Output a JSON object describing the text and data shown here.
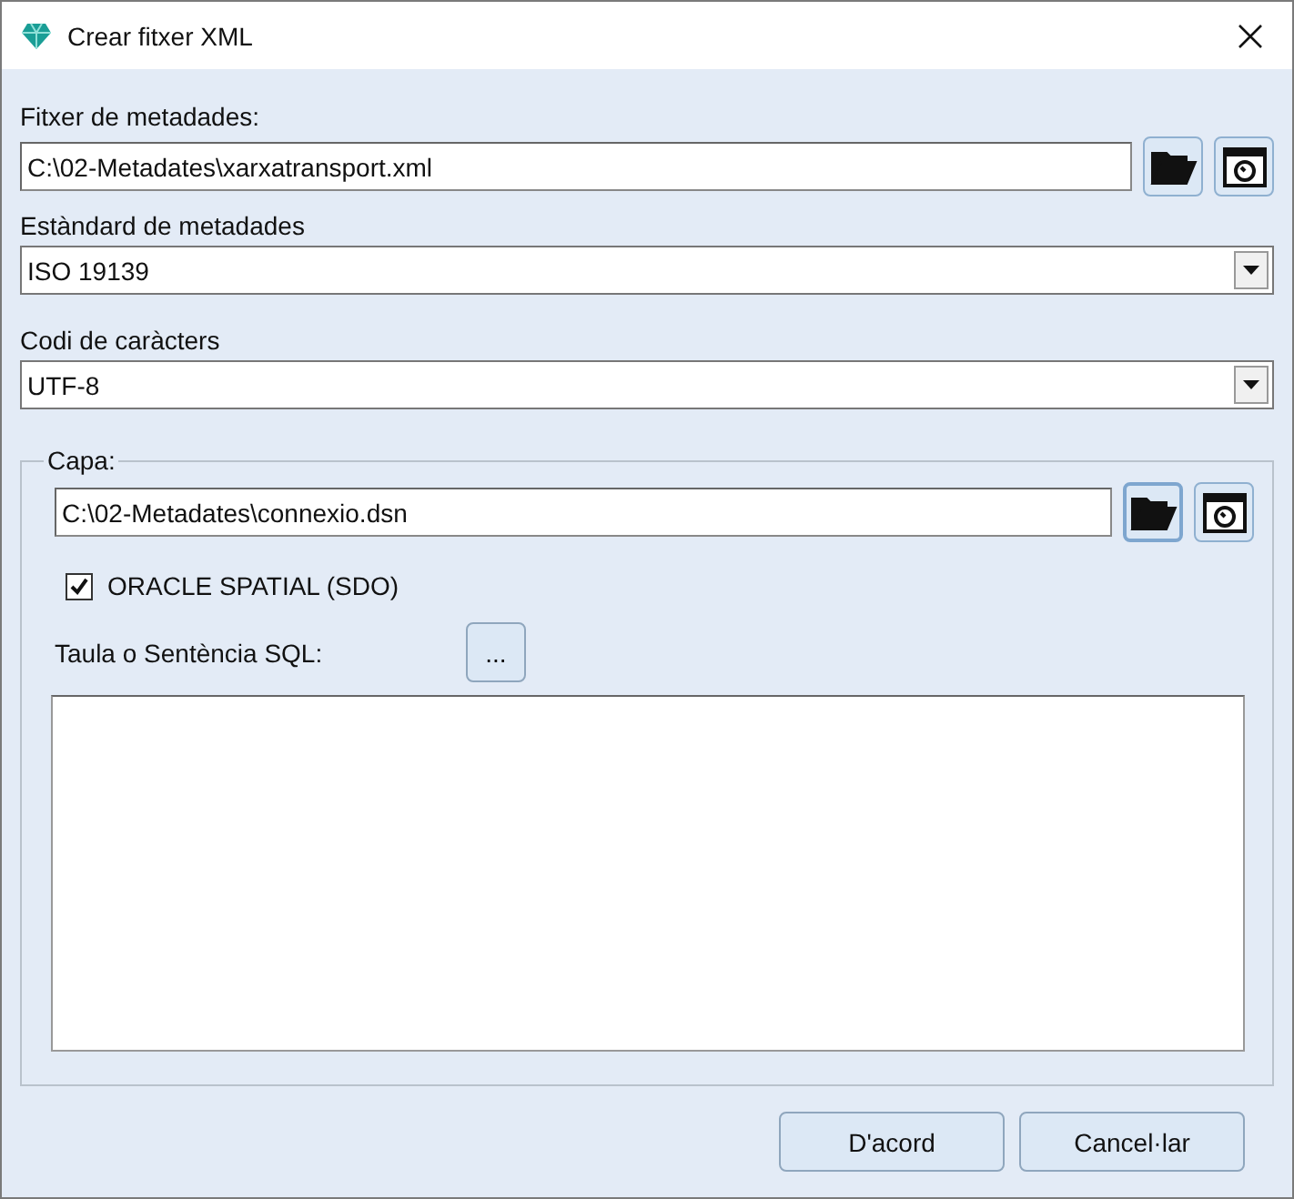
{
  "window": {
    "title": "Crear fitxer XML"
  },
  "metadata_file": {
    "label": "Fitxer de metadades:",
    "value": "C:\\02-Metadates\\xarxatransport.xml"
  },
  "standard": {
    "label": "Estàndard de metadades",
    "value": "ISO 19139"
  },
  "encoding": {
    "label": "Codi de caràcters",
    "value": "UTF-8"
  },
  "layer": {
    "label": "Capa:",
    "value": "C:\\02-Metadates\\connexio.dsn",
    "oracle": {
      "label": "ORACLE SPATIAL (SDO)",
      "checked": true
    },
    "sql_label": "Taula o Sentència SQL:",
    "sql_button": "..."
  },
  "buttons": [
    "D'acord",
    "Cancel·lar"
  ]
}
